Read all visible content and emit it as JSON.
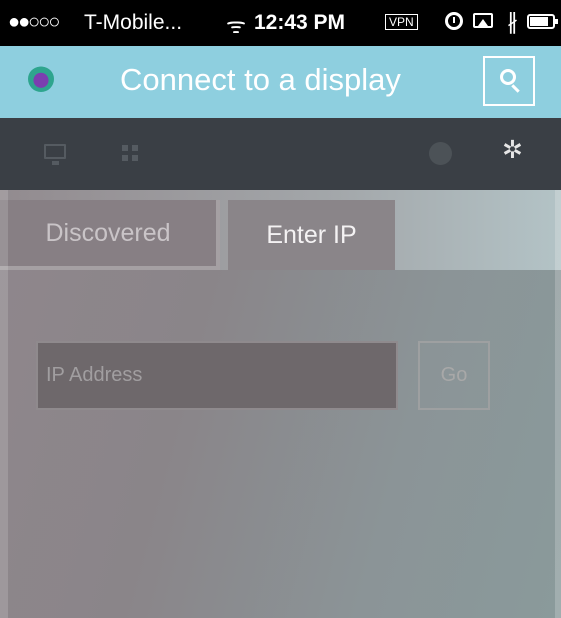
{
  "status_bar": {
    "signal": "●●○○○",
    "carrier": "T-Mobile...",
    "wifi_icon": "wifi-icon",
    "time": "12:43 PM",
    "vpn": "VPN",
    "battery_level": 0.8
  },
  "header": {
    "title": "Connect to a display",
    "search_icon": "search-icon",
    "logo_icon": "app-logo"
  },
  "toolbar": {
    "icons": [
      "monitor-icon",
      "grid-icon",
      "globe-icon",
      "gear-icon"
    ],
    "gear_glyph": "✲"
  },
  "tabs": [
    {
      "label": "Discovered",
      "active": false
    },
    {
      "label": "Enter IP",
      "active": true
    }
  ],
  "form": {
    "ip_placeholder": "IP Address",
    "ip_value": "",
    "go_label": "Go"
  },
  "colors": {
    "header_bg": "#8ecfdf",
    "toolbar_bg": "#3a3f45",
    "status_bg": "#000000"
  }
}
